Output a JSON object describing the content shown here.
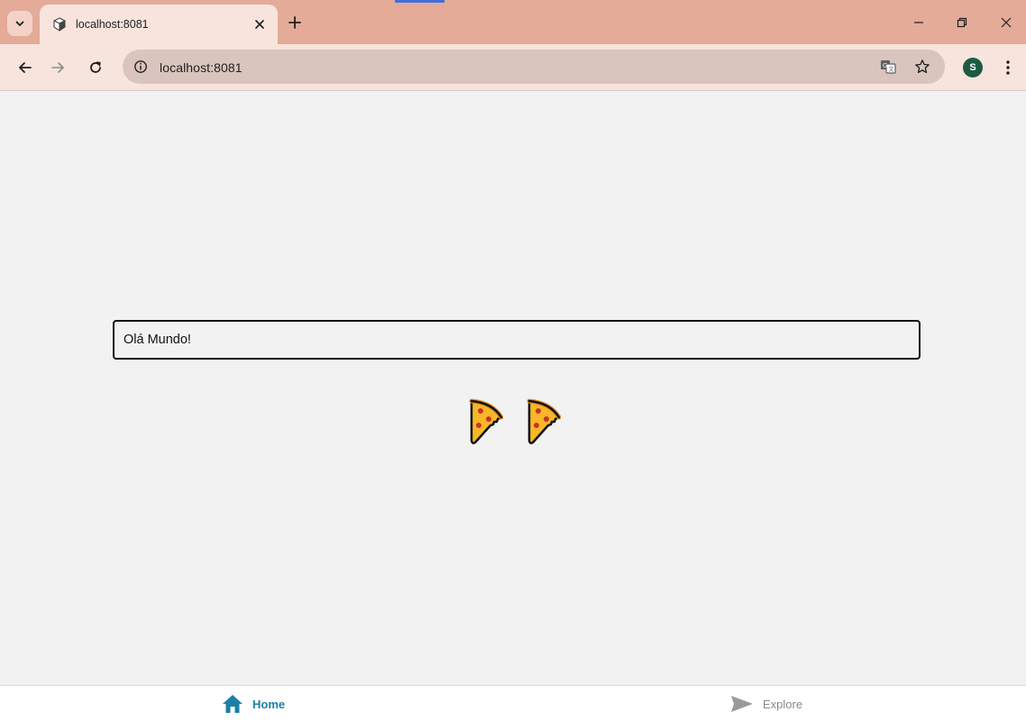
{
  "browser": {
    "tab_title": "localhost:8081",
    "url": "localhost:8081",
    "profile_initial": "S"
  },
  "page": {
    "input_value": "Olá Mundo!",
    "pizza_count": 2,
    "pizza_emoji": "pizza-icon"
  },
  "bottom_nav": {
    "home_label": "Home",
    "explore_label": "Explore",
    "active_color": "#1b7fa8",
    "inactive_color": "#8a8a8a"
  },
  "colors": {
    "tabstrip": "#e3ab98",
    "toolbar": "#f7e4dd",
    "omnibox": "#d9c5bd",
    "page_bg": "#f2f2f2",
    "profile_avatar": "#1c5a45"
  }
}
